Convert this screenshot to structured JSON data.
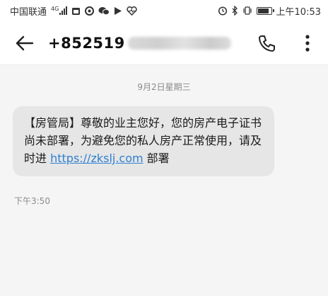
{
  "status_bar": {
    "carrier": "中国联通",
    "network": "4G",
    "time": "上午10:53"
  },
  "header": {
    "contact_prefix": "+852519",
    "contact_hidden": true
  },
  "conversation": {
    "date": "9月2日星期三",
    "message": {
      "text_before_link": "【房管局】尊敬的业主您好，您的房产电子证书尚未部署，为避免您的私人房产正常使用，请及时进 ",
      "link": "https://zkslj.com",
      "text_after_link": " 部署",
      "time": "下午3:50"
    }
  },
  "colors": {
    "bubble": "#e6e6e6",
    "link": "#2f7fd3",
    "background": "#f5f5f5"
  }
}
